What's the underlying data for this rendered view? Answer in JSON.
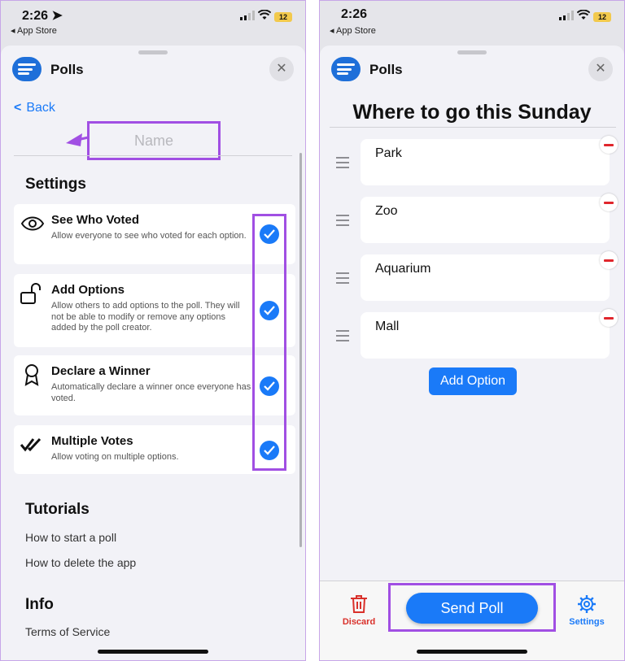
{
  "status": {
    "time": "2:26",
    "back_app": "App Store",
    "battery": "12"
  },
  "app": {
    "title": "Polls",
    "close_symbol": "✕"
  },
  "left": {
    "back_label": "Back",
    "name_placeholder": "Name",
    "settings_title": "Settings",
    "settings": [
      {
        "icon": "eye-icon",
        "title": "See Who Voted",
        "desc": "Allow everyone to see who voted for each option.",
        "checked": true
      },
      {
        "icon": "unlock-icon",
        "title": "Add Options",
        "desc": "Allow others to add options to the poll. They will not be able to modify or remove any options added by the poll creator.",
        "checked": true
      },
      {
        "icon": "award-ribbon-icon",
        "title": "Declare a Winner",
        "desc": "Automatically declare a winner once everyone has voted.",
        "checked": true
      },
      {
        "icon": "double-check-icon",
        "title": "Multiple Votes",
        "desc": "Allow voting on multiple options.",
        "checked": true
      }
    ],
    "tutorials_title": "Tutorials",
    "tutorials": [
      "How to start a poll",
      "How to delete the app"
    ],
    "info_title": "Info",
    "info_links": [
      "Terms of Service"
    ]
  },
  "right": {
    "poll_title": "Where to go this Sunday",
    "options": [
      "Park",
      "Zoo",
      "Aquarium",
      "Mall"
    ],
    "add_option_label": "Add Option",
    "discard_label": "Discard",
    "send_label": "Send Poll",
    "settings_label": "Settings"
  },
  "colors": {
    "accent": "#1a7af8",
    "highlight": "#a14fe3",
    "danger": "#e0262c",
    "discard": "#d9302a"
  }
}
